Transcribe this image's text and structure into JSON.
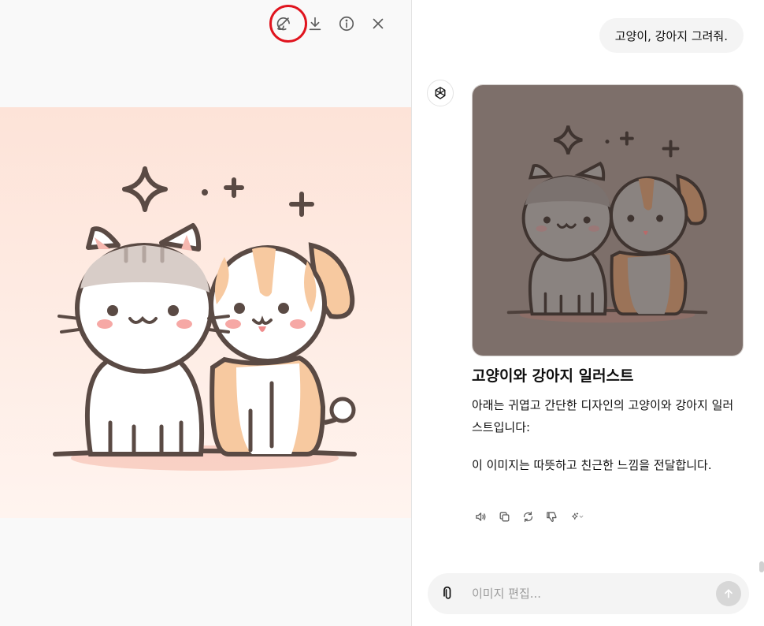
{
  "viewer": {
    "toolbar": {
      "edit_icon": "brush-edit-icon",
      "download_icon": "download-icon",
      "info_icon": "info-icon",
      "close_icon": "close-icon",
      "highlight_color": "#e0141e"
    },
    "image_alt": "고양이와 강아지 일러스트"
  },
  "chat": {
    "user_message": "고양이, 강아지 그려줘.",
    "assistant": {
      "avatar_icon": "openai-logo-icon",
      "title": "고양이와 강아지 일러스트",
      "paragraph_1": "아래는 귀엽고 간단한 디자인의 고양이와 강아지 일러스트입니다:",
      "paragraph_2": "이 이미지는 따뜻하고 친근한 느낌을 전달합니다.",
      "actions": [
        "read-aloud-icon",
        "copy-icon",
        "regenerate-icon",
        "thumbs-down-icon",
        "sparkle-model-icon"
      ]
    },
    "composer": {
      "placeholder": "이미지 편집...",
      "attach_icon": "paperclip-icon",
      "send_icon": "arrow-up-icon"
    }
  },
  "colors": {
    "bg_left": "#f9f9f9",
    "image_bg": "#fde4da",
    "outline": "#5a4a44",
    "dog_fur": "#f7c9a0",
    "cat_stripe": "#c9bdb7",
    "blush": "#f6a8a5"
  }
}
